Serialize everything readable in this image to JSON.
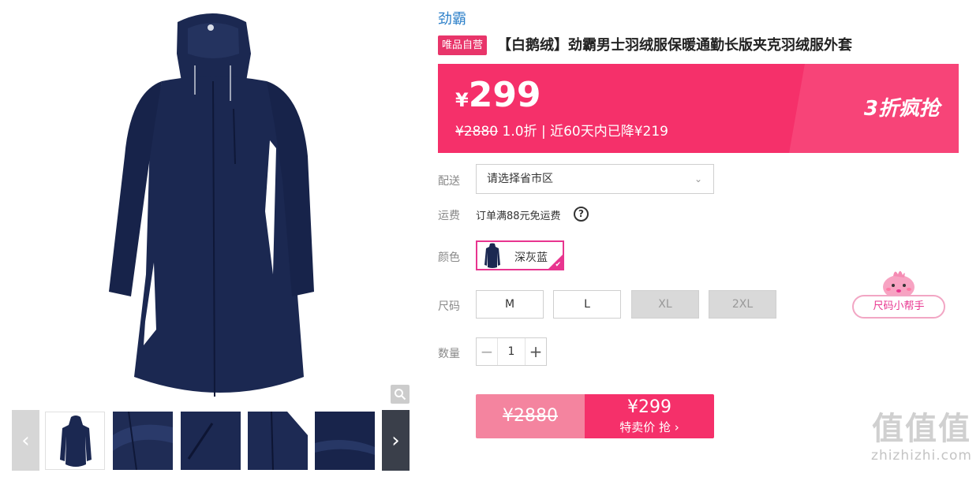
{
  "gallery": {
    "main_image_alt": "深灰蓝",
    "coat_color": "#1b2851",
    "accent_color": "#ffffff",
    "thumbnails_count": 5,
    "prev_icon": "chevron-left-icon",
    "next_icon": "chevron-right-icon",
    "zoom_icon": "magnifier-icon"
  },
  "product": {
    "brand": "劲霸",
    "badge": "唯品自营",
    "title": "【白鹅绒】劲霸男士羽绒服保暖通勤长版夹克羽绒服外套"
  },
  "price": {
    "currency": "¥",
    "current": "299",
    "original": "¥2880",
    "discount": "1.0折",
    "separator": "|",
    "drop_note": "近60天内已降¥219",
    "promo": "3折疯抢",
    "banner_color": "#f5306a"
  },
  "delivery": {
    "label": "配送",
    "placeholder": "请选择省市区"
  },
  "shipping": {
    "label": "运费",
    "text": "订单满88元免运费",
    "help_icon": "?"
  },
  "color": {
    "label": "颜色",
    "selected": "深灰蓝"
  },
  "size": {
    "label": "尺码",
    "options": [
      {
        "label": "M",
        "available": true
      },
      {
        "label": "L",
        "available": true
      },
      {
        "label": "XL",
        "available": false
      },
      {
        "label": "2XL",
        "available": false
      }
    ],
    "helper": "尺码小帮手"
  },
  "quantity": {
    "label": "数量",
    "value": "1",
    "minus": "−",
    "plus": "+"
  },
  "buy": {
    "old_price": "¥2880",
    "price": "¥299",
    "action": "特卖价 抢 ›"
  },
  "watermark": {
    "logo": "值值值",
    "url": "zhizhizhi.com"
  }
}
